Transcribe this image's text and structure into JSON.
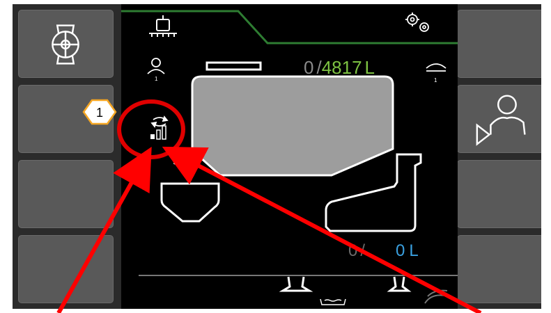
{
  "header": {
    "tab_left_icon": "sprayer-boom-icon",
    "tab_right_icon": "settings-gears-icon"
  },
  "left_buttons": [
    {
      "name": "pump-valve-button",
      "icon": "pump-valve-icon"
    },
    {
      "name": "empty-soft-key-2"
    },
    {
      "name": "empty-soft-key-3"
    },
    {
      "name": "empty-soft-key-4"
    }
  ],
  "right_buttons": [
    {
      "name": "empty-soft-key-1"
    },
    {
      "name": "operator-start-button",
      "icon": "operator-play-icon"
    },
    {
      "name": "empty-soft-key-3"
    },
    {
      "name": "empty-soft-key-4"
    }
  ],
  "main_tank": {
    "current": "0",
    "separator": "/",
    "capacity": "4817",
    "unit": "L",
    "capacity_color": "#7dc242",
    "fill_color": "#9d9d9d"
  },
  "rinse_tank": {
    "current": "0",
    "separator": "/",
    "amount": "0",
    "unit": "L",
    "amount_color": "#3aa0e0"
  },
  "status_icons": [
    "operator-1-icon",
    "fill-mode-cycle-icon",
    "signal-strength-icon",
    "nozzle-1-icon",
    "induction-hopper-icon",
    "boom-section-icon",
    "catch-tray-icon",
    "flush-icon"
  ],
  "callout": {
    "number": "1",
    "badge_color": "#f5a623",
    "circle_color": "#e00000",
    "arrow_color": "#ff0000"
  }
}
